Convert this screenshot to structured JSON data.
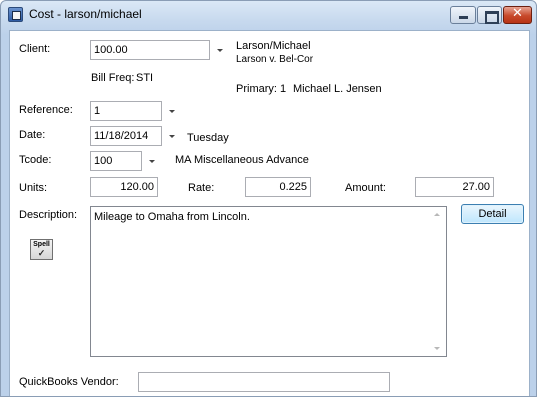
{
  "window": {
    "title": "Cost - larson/michael"
  },
  "client": {
    "label": "Client:",
    "value": "100.00",
    "name": "Larson/Michael",
    "matter": "Larson v. Bel-Cor",
    "bill_freq_label": "Bill Freq:",
    "bill_freq_value": "STI",
    "primary_label": "Primary:",
    "primary_number": "1",
    "primary_name": "Michael L. Jensen"
  },
  "reference": {
    "label": "Reference:",
    "value": "1"
  },
  "date": {
    "label": "Date:",
    "value": "11/18/2014",
    "weekday": "Tuesday"
  },
  "tcode": {
    "label": "Tcode:",
    "value": "100",
    "description": "MA Miscellaneous Advance"
  },
  "units": {
    "label": "Units:",
    "value": "120.00"
  },
  "rate": {
    "label": "Rate:",
    "value": "0.225"
  },
  "amount": {
    "label": "Amount:",
    "value": "27.00"
  },
  "description": {
    "label": "Description:",
    "value": "Mileage to Omaha from Lincoln."
  },
  "buttons": {
    "detail": "Detail",
    "spell": "Spell"
  },
  "quickbooks": {
    "label": "QuickBooks Vendor:",
    "value": ""
  }
}
